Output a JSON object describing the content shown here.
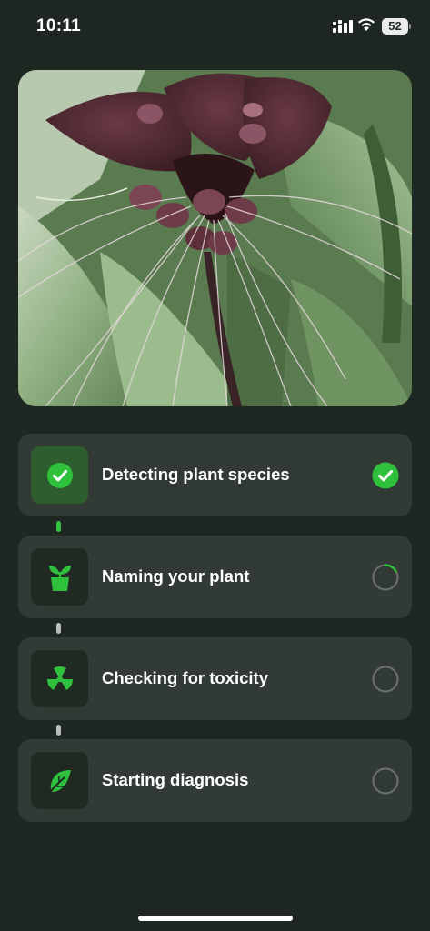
{
  "status_bar": {
    "time": "10:11",
    "battery_level": "52",
    "icons": [
      "signal-icon",
      "wifi-icon",
      "battery-icon"
    ]
  },
  "photo": {
    "subject_icon": "plant-photo"
  },
  "steps": [
    {
      "label": "Detecting plant species",
      "icon": "check-circle-icon",
      "status": "complete"
    },
    {
      "label": "Naming your plant",
      "icon": "plant-pot-icon",
      "status": "in-progress"
    },
    {
      "label": "Checking for toxicity",
      "icon": "radiation-icon",
      "status": "pending"
    },
    {
      "label": "Starting diagnosis",
      "icon": "leaf-icon",
      "status": "pending"
    }
  ],
  "colors": {
    "background": "#1f2722",
    "card": "#323a35",
    "accent_green": "#35c142",
    "done_tile": "#2e5d2f"
  }
}
